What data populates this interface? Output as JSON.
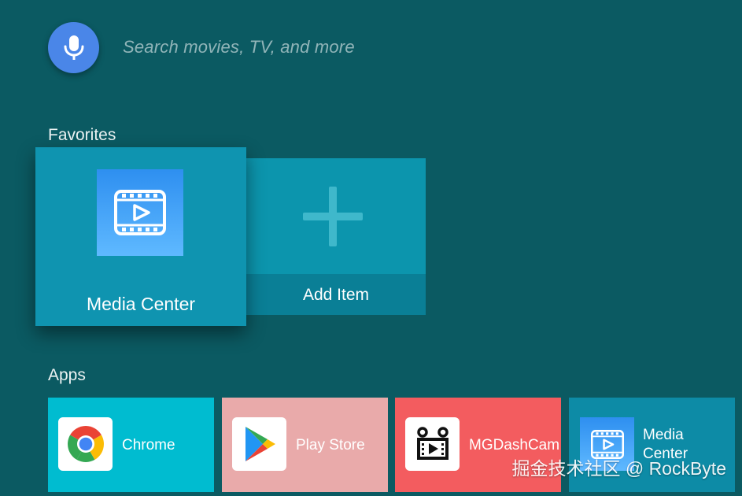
{
  "search": {
    "mic_icon": "microphone-icon",
    "placeholder": "Search movies, TV, and more"
  },
  "favorites": {
    "title": "Favorites",
    "items": [
      {
        "label": "Media Center",
        "icon": "media-center-icon",
        "focused": true
      },
      {
        "label": "Add Item",
        "icon": "plus-icon",
        "focused": false
      }
    ]
  },
  "apps": {
    "title": "Apps",
    "items": [
      {
        "label": "Chrome",
        "icon": "chrome-icon",
        "color": "#00bcd0"
      },
      {
        "label": "Play Store",
        "icon": "play-store-icon",
        "color": "#e9aaaa"
      },
      {
        "label": "MGDashCam",
        "icon": "dashcam-icon",
        "color": "#f35c5f"
      },
      {
        "label": "Media Center",
        "icon": "media-center-icon",
        "color": "#0d8ba6"
      }
    ]
  },
  "colors": {
    "background": "#0b5a62",
    "mic_button": "#4a86e8",
    "card": "#0d8ba6"
  },
  "watermark": "掘金技术社区 @ RockByte"
}
